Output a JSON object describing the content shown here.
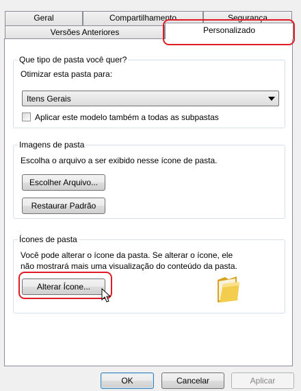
{
  "tabs": {
    "row1": [
      "Geral",
      "Compartilhamento",
      "Segurança"
    ],
    "row2": [
      "Versões Anteriores",
      "Personalizado"
    ]
  },
  "folder_type": {
    "legend": "Que tipo de pasta você quer?",
    "optimize_label": "Otimizar esta pasta para:",
    "selected": "Itens Gerais",
    "apply_subfolders_label": "Aplicar este modelo também a todas as subpastas",
    "apply_subfolders_checked": false
  },
  "folder_images": {
    "legend": "Imagens de pasta",
    "description": "Escolha o arquivo a ser exibido nesse ícone de pasta.",
    "choose_file_button": "Escolher Arquivo...",
    "restore_default_button": "Restaurar Padrão"
  },
  "folder_icons": {
    "legend": "Ícones de pasta",
    "description_line1": "Você pode alterar o ícone da pasta. Se alterar o ícone, ele",
    "description_line2": "não mostrará mais uma visualização do conteúdo da pasta.",
    "change_icon_button": "Alterar Ícone...",
    "icon": "folder-icon"
  },
  "footer": {
    "ok": "OK",
    "cancel": "Cancelar",
    "apply": "Aplicar"
  },
  "colors": {
    "highlight": "#e01a22",
    "accent": "#3c7fb1"
  }
}
